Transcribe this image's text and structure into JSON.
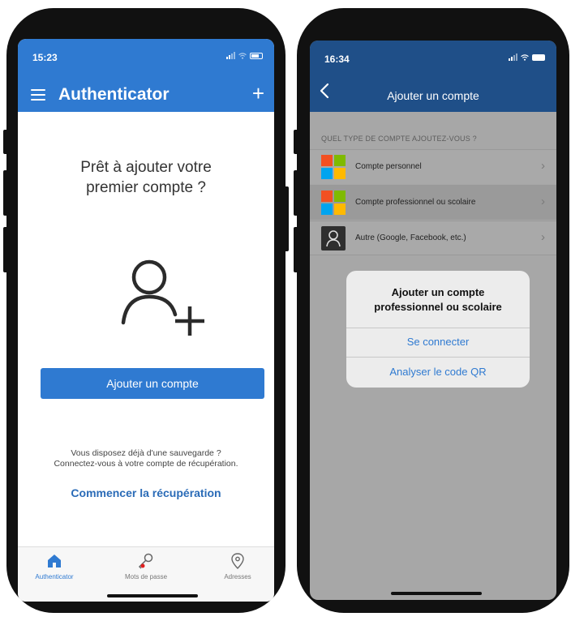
{
  "screen1": {
    "status_time": "15:23",
    "app_title": "Authenticator",
    "ready_line1": "Prêt à ajouter votre",
    "ready_line2": "premier compte ?",
    "add_account_label": "Ajouter un compte",
    "backup_line1": "Vous disposez déjà d'une sauvegarde ?",
    "backup_line2": "Connectez-vous à votre compte de récupération.",
    "recover_label": "Commencer la récupération",
    "tabs": [
      {
        "label": "Authenticator",
        "icon": "home-icon",
        "active": true
      },
      {
        "label": "Mots de passe",
        "icon": "key-icon",
        "active": false
      },
      {
        "label": "Adresses",
        "icon": "location-icon",
        "active": false
      }
    ]
  },
  "screen2": {
    "status_time": "16:34",
    "title": "Ajouter un compte",
    "section_header": "QUEL TYPE DE COMPTE AJOUTEZ-VOUS ?",
    "rows": [
      {
        "label": "Compte personnel",
        "icon": "microsoft-logo-icon"
      },
      {
        "label": "Compte professionnel ou scolaire",
        "icon": "microsoft-logo-icon"
      },
      {
        "label": "Autre (Google, Facebook, etc.)",
        "icon": "person-icon"
      }
    ],
    "dialog": {
      "title_line1": "Ajouter un compte",
      "title_line2": "professionnel ou scolaire",
      "sign_in": "Se connecter",
      "scan_qr": "Analyser le code QR"
    }
  },
  "colors": {
    "accent": "#2f7ad1",
    "nav_dark": "#1f4f88",
    "ms_red": "#f25022",
    "ms_green": "#7fba00",
    "ms_blue": "#00a4ef",
    "ms_yellow": "#ffb900"
  }
}
